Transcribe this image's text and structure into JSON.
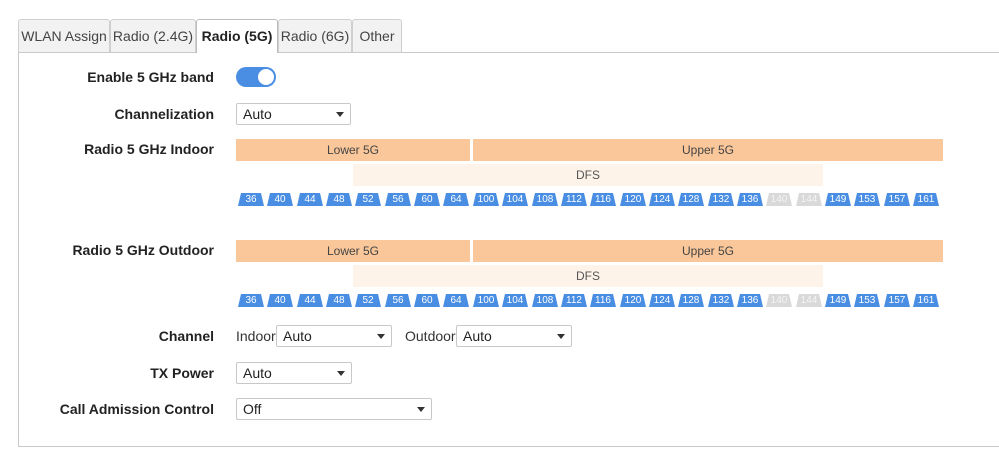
{
  "tabs": [
    {
      "label": "WLAN Assign",
      "active": false
    },
    {
      "label": "Radio (2.4G)",
      "active": false
    },
    {
      "label": "Radio (5G)",
      "active": true
    },
    {
      "label": "Radio (6G)",
      "active": false
    },
    {
      "label": "Other",
      "active": false
    }
  ],
  "form": {
    "enable_label": "Enable 5 GHz band",
    "enable_value": true,
    "channelization_label": "Channelization",
    "channelization_value": "Auto",
    "indoor_label": "Radio 5 GHz Indoor",
    "outdoor_label": "Radio 5 GHz Outdoor",
    "channel_label": "Channel",
    "indoor_text": "Indoor",
    "indoor_value": "Auto",
    "outdoor_text": "Outdoor",
    "outdoor_value": "Auto",
    "txpower_label": "TX Power",
    "txpower_value": "Auto",
    "cac_label": "Call Admission Control",
    "cac_value": "Off"
  },
  "spectrum": {
    "lower_label": "Lower 5G",
    "upper_label": "Upper 5G",
    "dfs_label": "DFS",
    "channels": [
      {
        "n": "36",
        "enabled": true
      },
      {
        "n": "40",
        "enabled": true
      },
      {
        "n": "44",
        "enabled": true
      },
      {
        "n": "48",
        "enabled": true
      },
      {
        "n": "52",
        "enabled": true
      },
      {
        "n": "56",
        "enabled": true
      },
      {
        "n": "60",
        "enabled": true
      },
      {
        "n": "64",
        "enabled": true
      },
      {
        "n": "100",
        "enabled": true
      },
      {
        "n": "104",
        "enabled": true
      },
      {
        "n": "108",
        "enabled": true
      },
      {
        "n": "112",
        "enabled": true
      },
      {
        "n": "116",
        "enabled": true
      },
      {
        "n": "120",
        "enabled": true
      },
      {
        "n": "124",
        "enabled": true
      },
      {
        "n": "128",
        "enabled": true
      },
      {
        "n": "132",
        "enabled": true
      },
      {
        "n": "136",
        "enabled": true
      },
      {
        "n": "140",
        "enabled": false
      },
      {
        "n": "144",
        "enabled": false
      },
      {
        "n": "149",
        "enabled": true
      },
      {
        "n": "153",
        "enabled": true
      },
      {
        "n": "157",
        "enabled": true
      },
      {
        "n": "161",
        "enabled": true
      }
    ]
  },
  "colors": {
    "accent": "#4a8ee3",
    "band": "#f9c79a",
    "dfs": "#fef3e8",
    "disabled": "#d9d9d9"
  }
}
